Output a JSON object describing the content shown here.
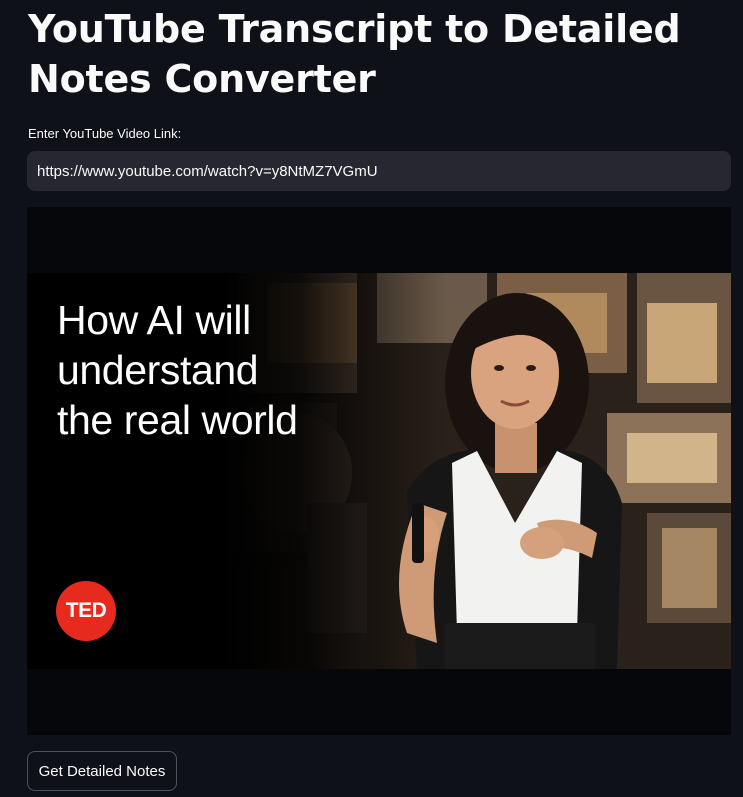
{
  "app": {
    "title": "YouTube Transcript to Detailed Notes Converter"
  },
  "form": {
    "input_label": "Enter YouTube Video Link:",
    "input_value": "https://www.youtube.com/watch?v=y8NtMZ7VGmU",
    "submit_label": "Get Detailed Notes"
  },
  "video": {
    "headline_lines": [
      "How AI will",
      "understand",
      "the real world"
    ],
    "logo_text": "TED"
  },
  "colors": {
    "background": "#0e1117",
    "input_background": "#262730",
    "text": "#fafafa",
    "ted_red": "#e62b1e"
  }
}
